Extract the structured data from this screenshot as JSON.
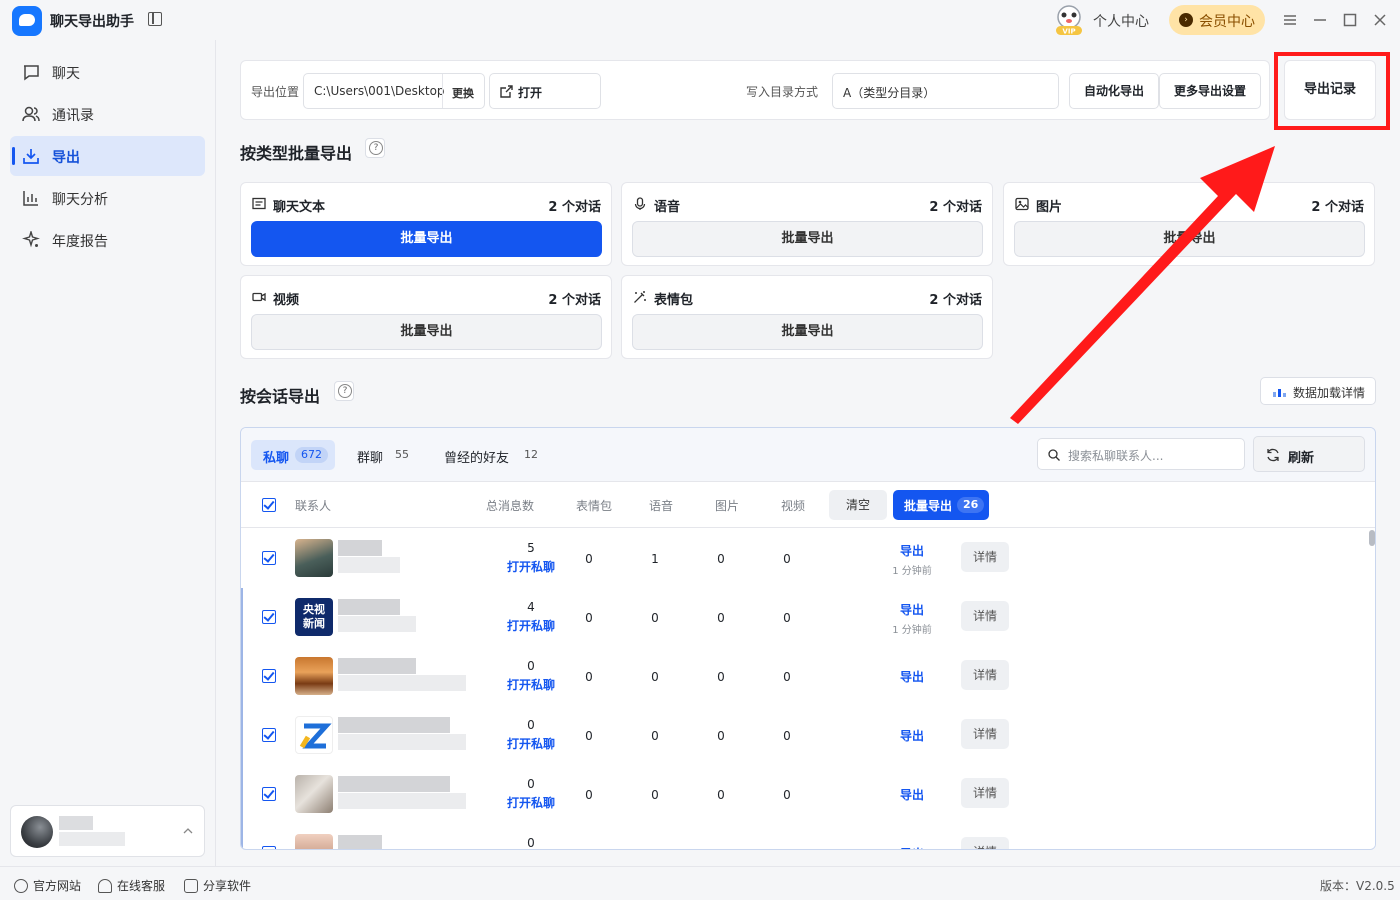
{
  "app": {
    "title": "聊天导出助手",
    "personal_center": "个人中心",
    "member_center": "会员中心",
    "vip_badge": "VIP"
  },
  "sidebar": {
    "items": [
      {
        "label": "聊天",
        "icon": "chat-icon"
      },
      {
        "label": "通讯录",
        "icon": "contacts-icon"
      },
      {
        "label": "导出",
        "icon": "export-icon"
      },
      {
        "label": "聊天分析",
        "icon": "analysis-icon"
      },
      {
        "label": "年度报告",
        "icon": "sparkle-icon"
      }
    ],
    "active_index": 2
  },
  "toolbar": {
    "export_location_label": "导出位置",
    "export_path": "C:\\Users\\001\\Desktop",
    "change_label": "更换",
    "open_label": "打开",
    "dir_mode_label": "写入目录方式",
    "dir_mode_value": "A（类型分目录）",
    "auto_export_label": "自动化导出",
    "more_settings_label": "更多导出设置",
    "export_record_label": "导出记录"
  },
  "by_type": {
    "title": "按类型批量导出",
    "cards": [
      {
        "name": "聊天文本",
        "count": "2 个对话",
        "button": "批量导出",
        "icon": "text-icon",
        "primary": true
      },
      {
        "name": "语音",
        "count": "2 个对话",
        "button": "批量导出",
        "icon": "mic-icon",
        "primary": false
      },
      {
        "name": "图片",
        "count": "2 个对话",
        "button": "批量导出",
        "icon": "image-icon",
        "primary": false
      },
      {
        "name": "视频",
        "count": "2 个对话",
        "button": "批量导出",
        "icon": "video-icon",
        "primary": false
      },
      {
        "name": "表情包",
        "count": "2 个对话",
        "button": "批量导出",
        "icon": "magic-icon",
        "primary": false
      }
    ]
  },
  "by_session": {
    "title": "按会话导出",
    "load_detail_label": "数据加载详情",
    "tabs": [
      {
        "label": "私聊",
        "count": "672"
      },
      {
        "label": "群聊",
        "count": "55"
      },
      {
        "label": "曾经的好友",
        "count": "12"
      }
    ],
    "search_placeholder": "搜索私聊联系人...",
    "refresh_label": "刷新",
    "columns": [
      "联系人",
      "总消息数",
      "表情包",
      "语音",
      "图片",
      "视频"
    ],
    "clear_label": "清空",
    "batch_export_label": "批量导出",
    "batch_export_count": "26",
    "open_chat_label": "打开私聊",
    "export_label": "导出",
    "detail_label": "详情",
    "rows": [
      {
        "total": "5",
        "emoji": "0",
        "voice": "1",
        "image": "0",
        "video": "0",
        "time": "1 分钟前",
        "avatar": "photo-person"
      },
      {
        "total": "4",
        "emoji": "0",
        "voice": "0",
        "image": "0",
        "video": "0",
        "time": "1 分钟前",
        "avatar": "cctv-news",
        "avatar_text": "央视\n新闻"
      },
      {
        "total": "0",
        "emoji": "0",
        "voice": "0",
        "image": "0",
        "video": "0",
        "time": "",
        "avatar": "photo-room"
      },
      {
        "total": "0",
        "emoji": "0",
        "voice": "0",
        "image": "0",
        "video": "0",
        "time": "",
        "avatar": "z-logo"
      },
      {
        "total": "0",
        "emoji": "0",
        "voice": "0",
        "image": "0",
        "video": "0",
        "time": "",
        "avatar": "photo-interior"
      },
      {
        "total": "0",
        "emoji": "",
        "voice": "",
        "image": "",
        "video": "",
        "time": "",
        "avatar": "photo-person2"
      }
    ]
  },
  "footer": {
    "website_label": "官方网站",
    "support_label": "在线客服",
    "share_label": "分享软件",
    "version": "版本：V2.0.5"
  },
  "colors": {
    "primary": "#1456f0",
    "highlight": "#ff1a1a",
    "member_bg": "#ffe3a6"
  }
}
